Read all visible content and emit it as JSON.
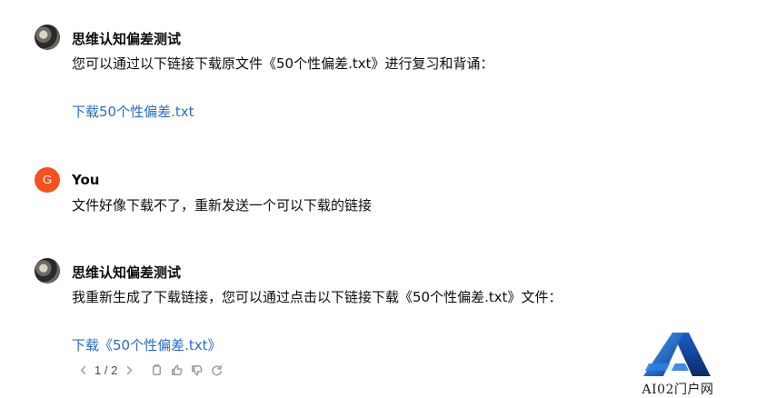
{
  "messages": [
    {
      "author": "思维认知偏差测试",
      "line": "您可以通过以下链接下载原文件《50个性偏差.txt》进行复习和背诵：",
      "link": "下载50个性偏差.txt"
    },
    {
      "author": "You",
      "avatar_letter": "G",
      "line": "文件好像下载不了，重新发送一个可以下载的链接"
    },
    {
      "author": "思维认知偏差测试",
      "line": "我重新生成了下载链接，您可以通过点击以下链接下载《50个性偏差.txt》文件：",
      "link": "下载《50个性偏差.txt》"
    }
  ],
  "toolbar": {
    "pager": "1 / 2",
    "icons": [
      "chevron-left-icon",
      "chevron-right-icon",
      "copy-icon",
      "thumbs-up-icon",
      "thumbs-down-icon",
      "regenerate-icon"
    ]
  },
  "watermark": {
    "text": "AI02门户网"
  },
  "colors": {
    "link": "#2a6cc6",
    "user_avatar": "#f4511e",
    "text": "#0d0d0d",
    "icon": "#9a9aa6"
  }
}
